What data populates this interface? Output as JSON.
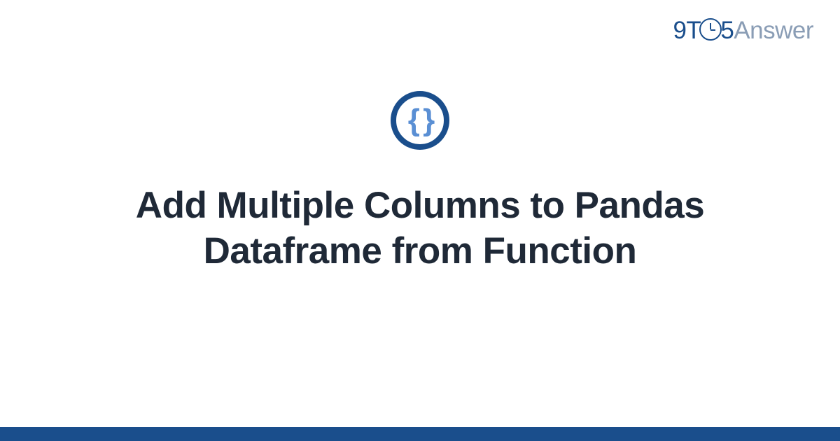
{
  "logo": {
    "part1": "9T",
    "part2": "5",
    "part3": "Answer"
  },
  "icon": {
    "braces": "{ }",
    "name": "code-braces-icon"
  },
  "title": "Add Multiple Columns to Pandas Dataframe from Function",
  "colors": {
    "primary": "#1a4e8c",
    "accent": "#5a8fd4",
    "muted": "#8a9db5",
    "text": "#1f2937"
  }
}
